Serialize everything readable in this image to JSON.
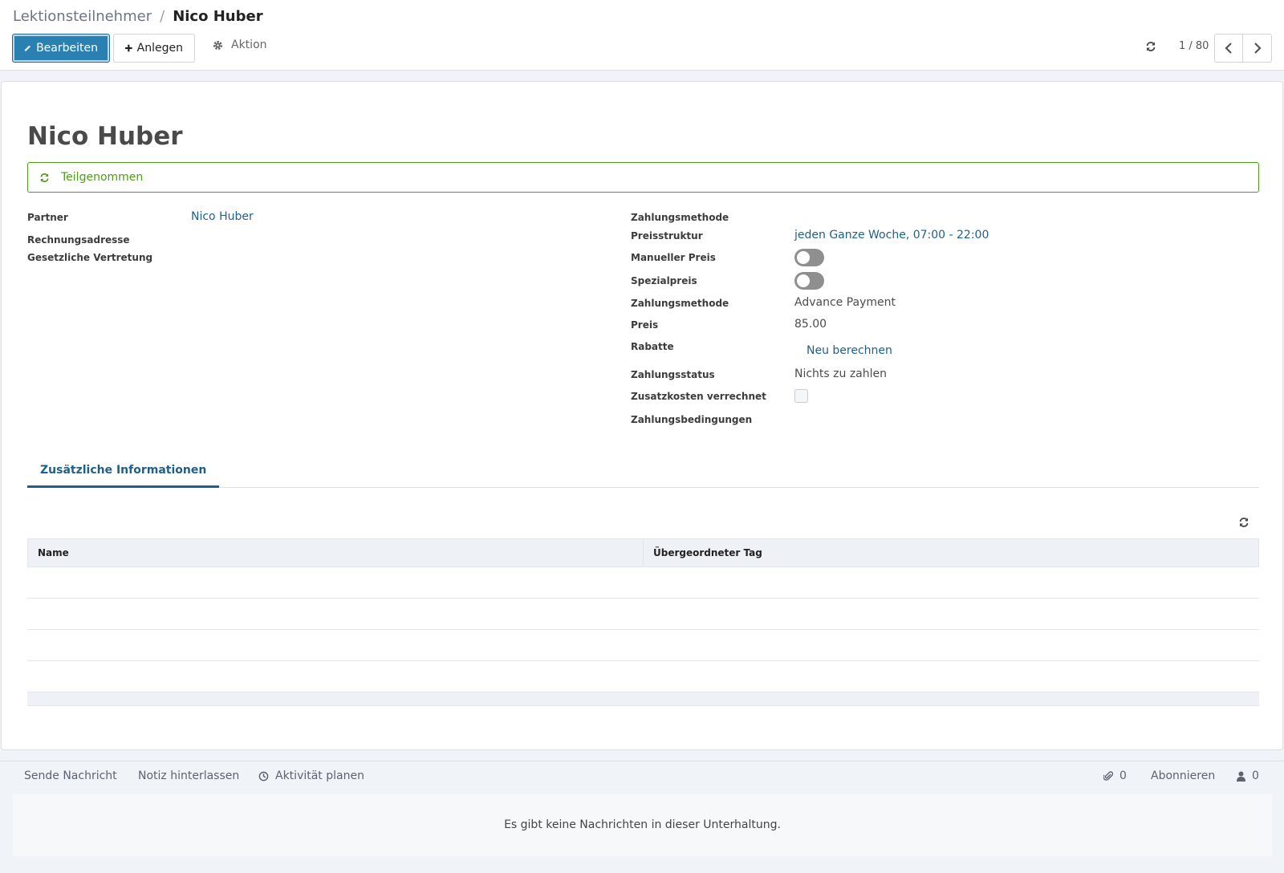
{
  "breadcrumb": {
    "parent": "Lektionsteilnehmer",
    "separator": "/",
    "current": "Nico Huber"
  },
  "toolbar": {
    "edit_label": "Bearbeiten",
    "create_label": "Anlegen",
    "action_label": "Aktion"
  },
  "pager": {
    "value": "1 / 80"
  },
  "record": {
    "title": "Nico Huber",
    "status": "Teilgenommen",
    "left_fields": [
      {
        "label": "Partner",
        "value": "Nico Huber"
      },
      {
        "label": "Rechnungsadresse",
        "value": ""
      },
      {
        "label": "Gesetzliche Vertretung",
        "value": ""
      }
    ],
    "right_fields": {
      "zahlungsmethode_top": "Zahlungsmethode",
      "preisstruktur_label": "Preisstruktur",
      "preisstruktur_value": "jeden Ganze Woche, 07:00 - 22:00",
      "manueller_preis_label": "Manueller Preis",
      "manueller_preis_on": false,
      "spezialpreis_label": "Spezialpreis",
      "spezialpreis_on": false,
      "zahlungsmethode_label": "Zahlungsmethode",
      "zahlungsmethode_value": "Advance Payment",
      "preis_label": "Preis",
      "preis_value": "85.00",
      "rabatte_label": "Rabatte",
      "rabatte_button": "Neu berechnen",
      "zahlungsstatus_label": "Zahlungsstatus",
      "zahlungsstatus_value": "Nichts zu zahlen",
      "zusatzkosten_label": "Zusatzkosten verrechnet",
      "zusatzkosten_checked": false,
      "zahlungsbedingungen_label": "Zahlungsbedingungen"
    }
  },
  "tabs": [
    {
      "label": "Zusätzliche Informationen",
      "active": true
    }
  ],
  "table": {
    "columns": [
      "Name",
      "Übergeordneter Tag"
    ],
    "rows": []
  },
  "chatter": {
    "send_message": "Sende Nachricht",
    "log_note": "Notiz hinterlassen",
    "schedule_activity": "Aktivität planen",
    "attachments_count": "0",
    "follow": "Abonnieren",
    "followers_count": "0",
    "empty_message": "Es gibt keine Nachrichten in dieser Unterhaltung."
  },
  "colors": {
    "primary": "#2a80b1",
    "link": "#1f5f8b",
    "status_green": "#4e9d18"
  }
}
